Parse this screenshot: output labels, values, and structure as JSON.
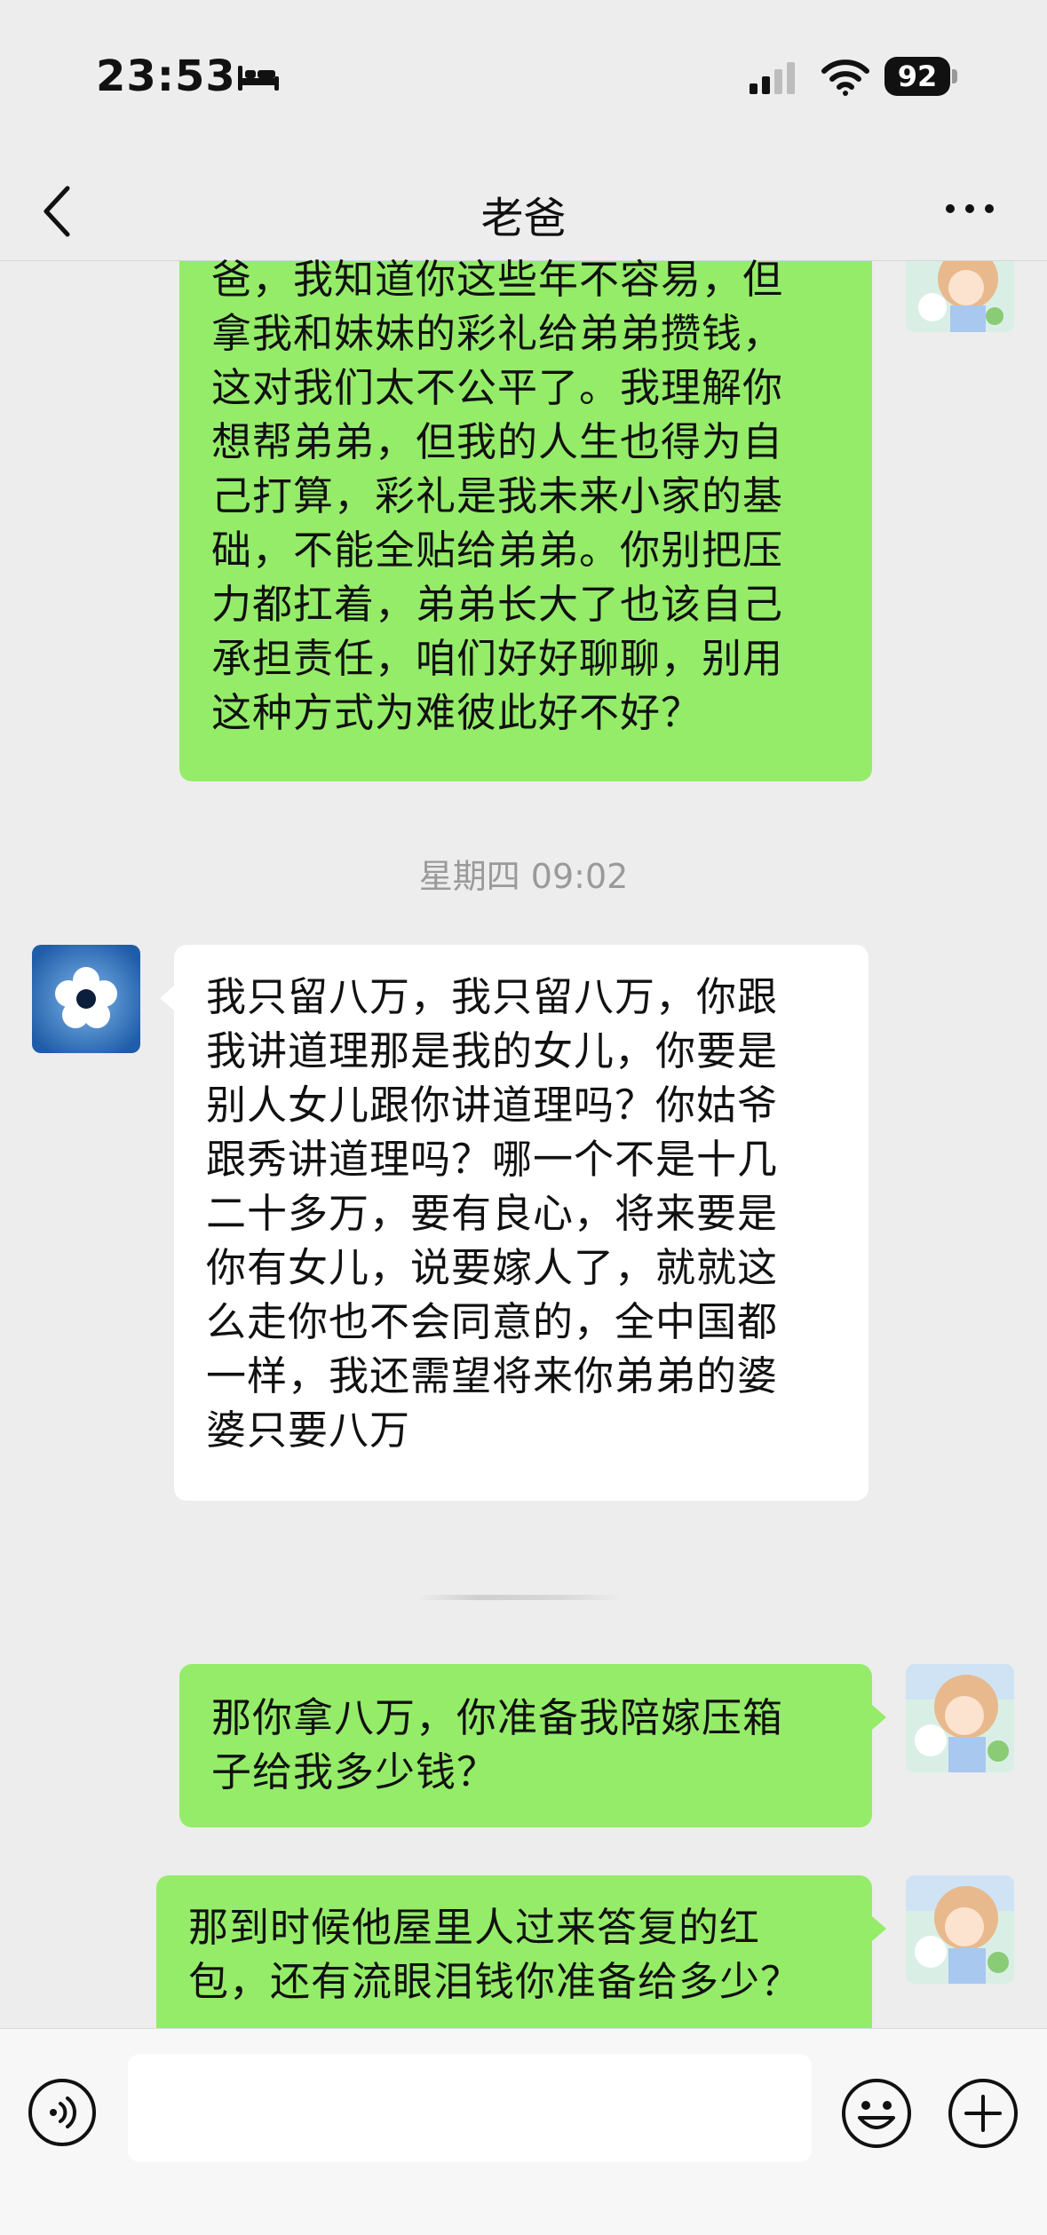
{
  "status_bar": {
    "time": "23:53",
    "battery": "92"
  },
  "nav": {
    "title": "老爸"
  },
  "messages": {
    "m1": {
      "sender": "me",
      "lines": [
        "爸，我知道你这些年不容易，但",
        "拿我和妹妹的彩礼给弟弟攒钱，",
        "这对我们太不公平了。我理解你",
        "想帮弟弟，但我的人生也得为自",
        "己打算，彩礼是我未来小家的基",
        "础，不能全贴给弟弟。你别把压",
        "力都扛着，弟弟长大了也该自己",
        "承担责任，咱们好好聊聊，别用",
        "这种方式为难彼此好不好？"
      ]
    },
    "timestamp": "星期四 09:02",
    "m2": {
      "sender": "them",
      "lines": [
        "我只留八万，我只留八万，你跟",
        "我讲道理那是我的女儿，你要是",
        "别人女儿跟你讲道理吗？你姑爷",
        "跟秀讲道理吗？哪一个不是十几",
        "二十多万，要有良心，将来要是",
        "你有女儿，说要嫁人了，就就这",
        "么走你也不会同意的，全中国都",
        "一样，我还需望将来你弟弟的婆",
        "婆只要八万"
      ]
    },
    "m3": {
      "sender": "me",
      "lines": [
        "那你拿八万，你准备我陪嫁压箱",
        "子给我多少钱？"
      ]
    },
    "m4": {
      "sender": "me",
      "lines": [
        "那到时候他屋里人过来答复的红",
        "包，还有流眼泪钱你准备给多少？"
      ]
    }
  },
  "colors": {
    "my_bubble": "#95EC69",
    "their_bubble": "#FFFFFF",
    "background": "#EDEDED"
  }
}
